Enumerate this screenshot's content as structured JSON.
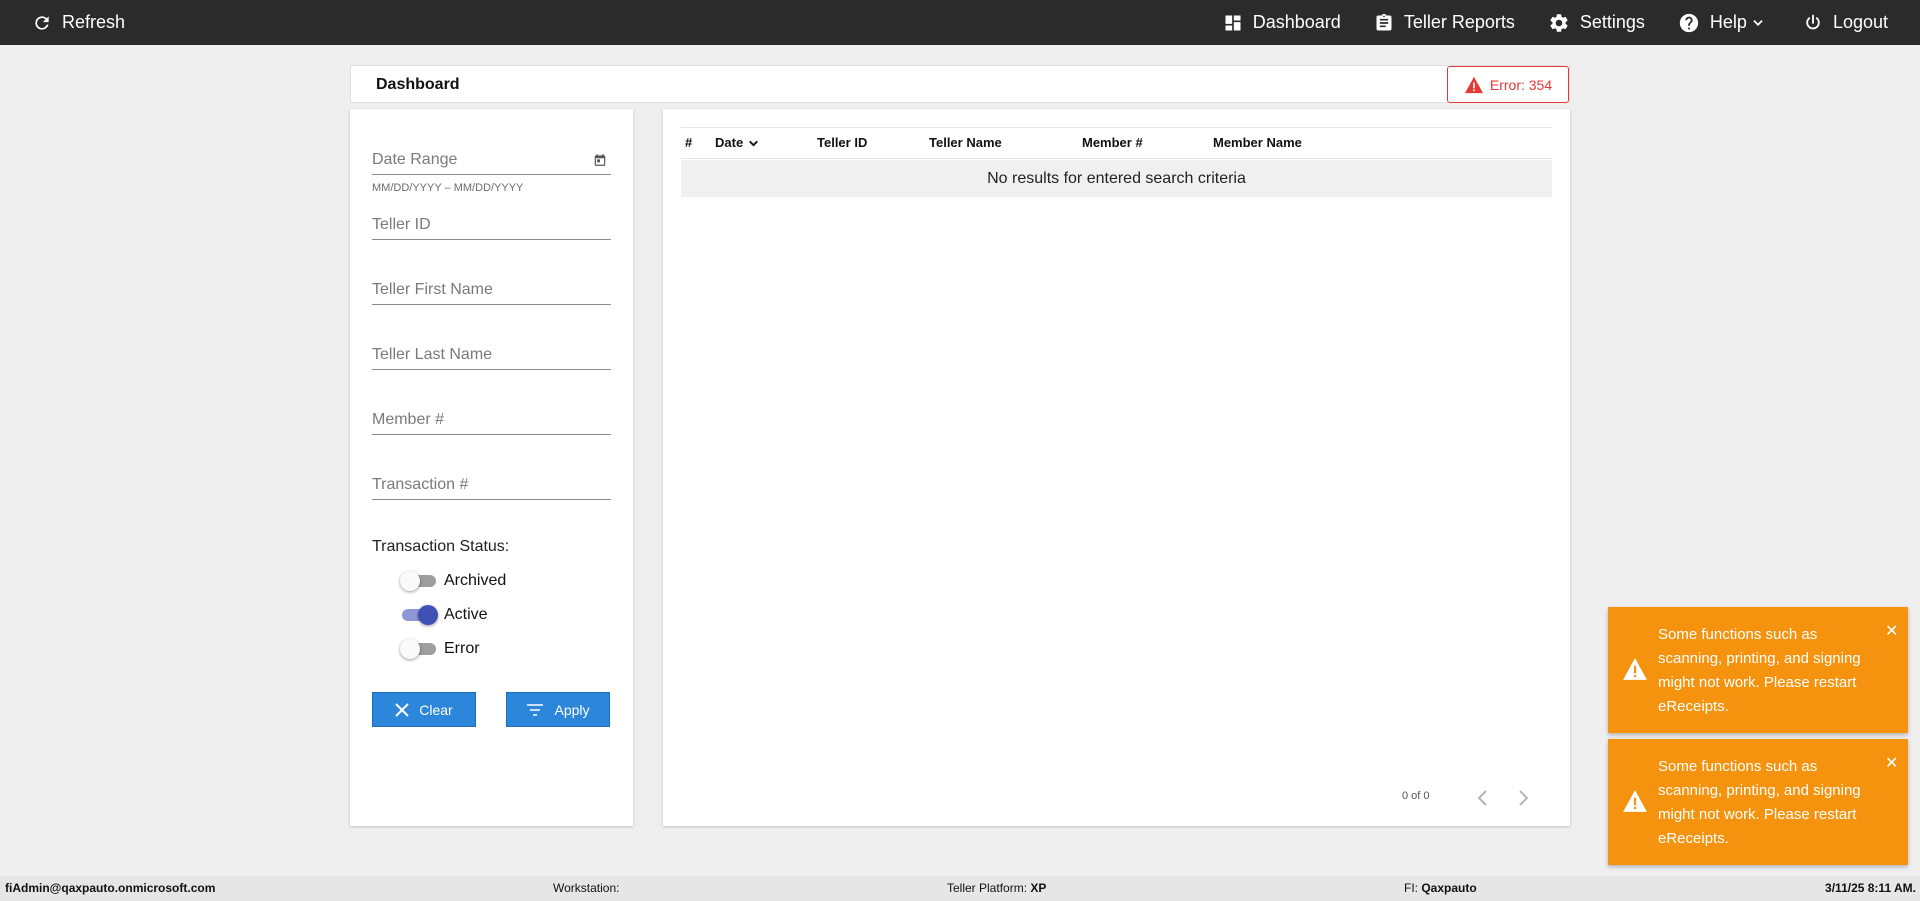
{
  "topbar": {
    "refresh_label": "Refresh",
    "nav": {
      "dashboard": "Dashboard",
      "teller_reports": "Teller Reports",
      "settings": "Settings",
      "help": "Help",
      "logout": "Logout"
    }
  },
  "header": {
    "title": "Dashboard",
    "error_label": "Error: 354"
  },
  "filters": {
    "date_range_placeholder": "Date Range",
    "date_range_hint": "MM/DD/YYYY – MM/DD/YYYY",
    "teller_id_placeholder": "Teller ID",
    "teller_first_name_placeholder": "Teller First Name",
    "teller_last_name_placeholder": "Teller Last Name",
    "member_number_placeholder": "Member #",
    "transaction_number_placeholder": "Transaction #",
    "status_label": "Transaction Status:",
    "statuses": [
      {
        "label": "Archived",
        "on": false
      },
      {
        "label": "Active",
        "on": true
      },
      {
        "label": "Error",
        "on": false
      }
    ],
    "clear_label": "Clear",
    "apply_label": "Apply"
  },
  "table": {
    "columns": [
      "#",
      "Date",
      "Teller ID",
      "Teller Name",
      "Member #",
      "Member Name"
    ],
    "empty_message": "No results for entered search criteria",
    "pager": "0 of 0"
  },
  "toasts": [
    {
      "message": "Some functions such as scanning, printing, and signing might not work. Please restart eReceipts."
    },
    {
      "message": "Some functions such as scanning, printing, and signing might not work. Please restart eReceipts."
    }
  ],
  "statusbar": {
    "user": "fiAdmin@qaxpauto.onmicrosoft.com",
    "workstation_label": "Workstation:",
    "workstation_value": "",
    "platform_label": "Teller Platform:",
    "platform_value": "XP",
    "fi_label": "FI:",
    "fi_value": "Qaxpauto",
    "datetime": "3/11/25 8:11 AM."
  },
  "colors": {
    "topbar": "#2b2b2b",
    "primary_button": "#2c86d9",
    "error": "#e53935",
    "toast": "#f5930f",
    "toggle_on": "#3f51b5"
  }
}
